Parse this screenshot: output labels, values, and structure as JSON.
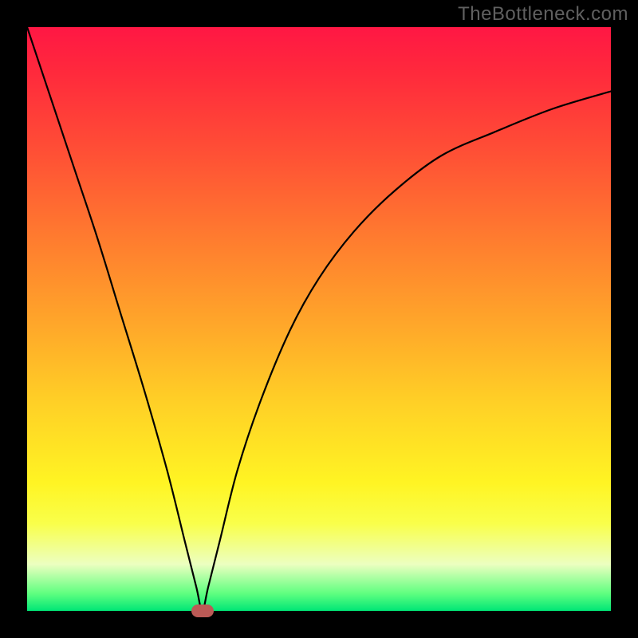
{
  "watermark": "TheBottleneck.com",
  "chart_data": {
    "type": "line",
    "title": "",
    "xlabel": "",
    "ylabel": "",
    "xlim": [
      0,
      100
    ],
    "ylim": [
      0,
      100
    ],
    "grid": false,
    "legend": false,
    "background_gradient": {
      "orientation": "vertical",
      "stops": [
        {
          "pos": 0.0,
          "color": "#ff1744"
        },
        {
          "pos": 0.5,
          "color": "#ffcf26"
        },
        {
          "pos": 0.85,
          "color": "#f9ff4a"
        },
        {
          "pos": 1.0,
          "color": "#00e676"
        }
      ]
    },
    "series": [
      {
        "name": "bottleneck-curve",
        "x": [
          0,
          4,
          8,
          12,
          16,
          20,
          24,
          27,
          29,
          30,
          31,
          33,
          36,
          40,
          45,
          50,
          56,
          63,
          71,
          80,
          90,
          100
        ],
        "y": [
          100,
          88,
          76,
          64,
          51,
          38,
          24,
          12,
          4,
          0,
          4,
          12,
          24,
          36,
          48,
          57,
          65,
          72,
          78,
          82,
          86,
          89
        ]
      }
    ],
    "marker": {
      "name": "optimum-marker",
      "x": 30,
      "y": 0,
      "color": "#bb5a56"
    }
  },
  "colors": {
    "frame": "#000000",
    "curve": "#000000",
    "watermark": "#606060"
  }
}
